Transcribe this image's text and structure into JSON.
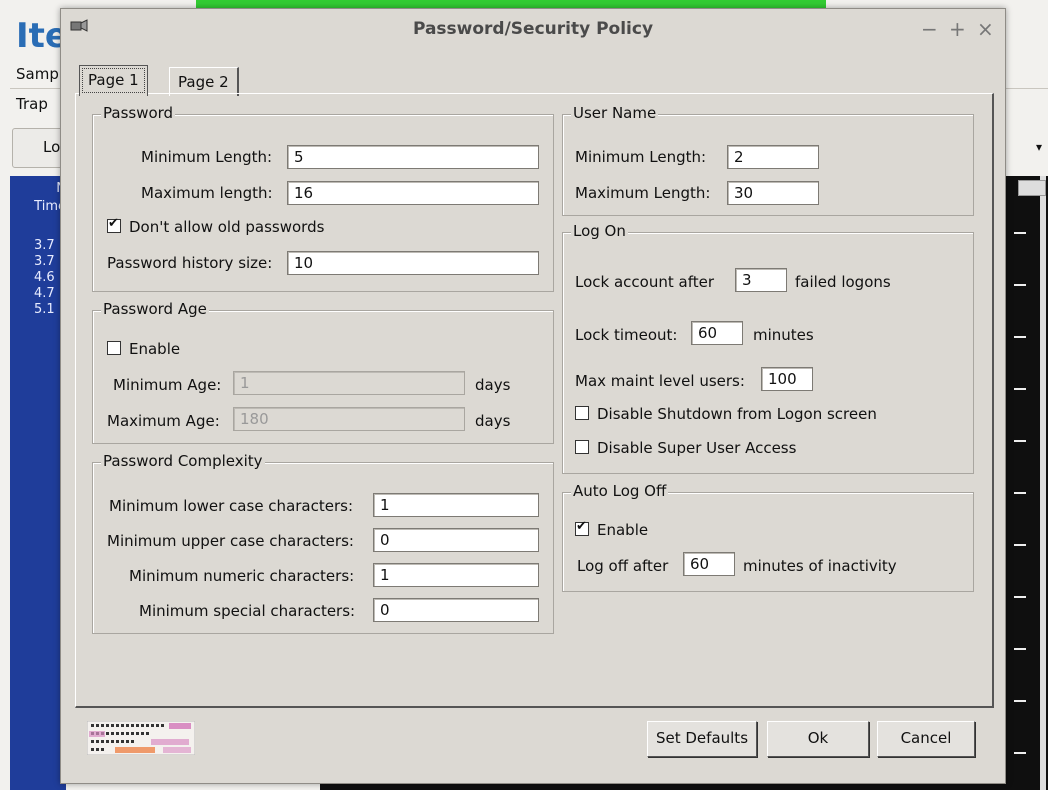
{
  "background": {
    "app_title": "Ite",
    "row1": "Samp",
    "row2": "Trap",
    "button": "Lo",
    "list_header": [
      "N",
      "Time"
    ],
    "list_values": [
      "3.7",
      "3.7",
      "4.6",
      "4.7",
      "5.1"
    ]
  },
  "dialog": {
    "title": "Password/Security Policy",
    "controls": {
      "minimize": "−",
      "maximize": "+",
      "close": "×"
    },
    "tabs": [
      {
        "label": "Page 1"
      },
      {
        "label": "Page 2"
      }
    ],
    "password": {
      "legend": "Password",
      "min_length_label": "Minimum Length:",
      "min_length": "5",
      "max_length_label": "Maximum length:",
      "max_length": "16",
      "no_old_label": "Don't allow old passwords",
      "no_old_checked": true,
      "history_label": "Password history size:",
      "history": "10"
    },
    "password_age": {
      "legend": "Password Age",
      "enable_label": "Enable",
      "enable_checked": false,
      "min_age_label": "Minimum Age:",
      "min_age": "1",
      "max_age_label": "Maximum Age:",
      "max_age": "180",
      "days": "days"
    },
    "complexity": {
      "legend": "Password Complexity",
      "lower_label": "Minimum lower case characters:",
      "lower": "1",
      "upper_label": "Minimum upper case characters:",
      "upper": "0",
      "numeric_label": "Minimum numeric characters:",
      "numeric": "1",
      "special_label": "Minimum special characters:",
      "special": "0"
    },
    "user_name": {
      "legend": "User Name",
      "min_length_label": "Minimum Length:",
      "min_length": "2",
      "max_length_label": "Maximum Length:",
      "max_length": "30"
    },
    "log_on": {
      "legend": "Log On",
      "lock_after_label": "Lock account after",
      "lock_after": "3",
      "failed_label": "failed logons",
      "timeout_label": "Lock timeout:",
      "timeout": "60",
      "minutes_label": "minutes",
      "max_maint_label": "Max maint level users:",
      "max_maint": "100",
      "disable_shutdown_label": "Disable Shutdown from Logon screen",
      "disable_shutdown_checked": false,
      "disable_super_label": "Disable Super User Access",
      "disable_super_checked": false
    },
    "auto_log_off": {
      "legend": "Auto Log Off",
      "enable_label": "Enable",
      "enable_checked": true,
      "log_off_after_label": "Log off after",
      "log_off_after": "60",
      "inactivity_label": "minutes of inactivity"
    },
    "buttons": {
      "set_defaults": "Set Defaults",
      "ok": "Ok",
      "cancel": "Cancel"
    }
  }
}
